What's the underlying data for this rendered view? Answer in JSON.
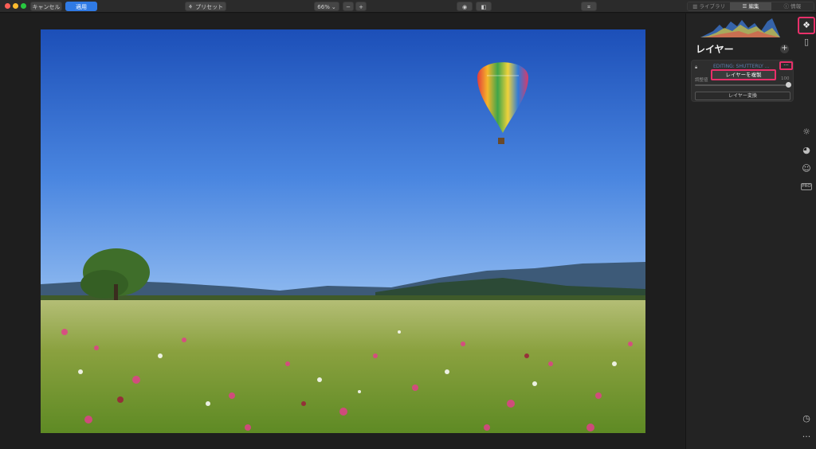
{
  "toolbar": {
    "cancel_label": "キャンセル",
    "apply_label": "適用",
    "presets_label": "プリセット",
    "zoom_label": "66%",
    "zoom_out_label": "−",
    "zoom_in_label": "+",
    "view_tabs": [
      "ライブラリ",
      "編集",
      "情報"
    ]
  },
  "panel": {
    "title": "レイヤー",
    "add_label": "+",
    "layer": {
      "name": "EDITING: SHUTTERLY ...",
      "more_label": "···",
      "tooltip": "レイヤーを複製",
      "opacity_label": "調整値",
      "opacity_value": "100",
      "convert_label": "レイヤー変換"
    }
  },
  "sidebar_icons": [
    "layers-icon",
    "canvas-icon",
    "sun-icon",
    "palette-icon",
    "face-icon",
    "pro-icon",
    "history-icon",
    "more-icon"
  ],
  "pro_label": "PRO",
  "colors": {
    "accent": "#2f7ae5",
    "highlight": "#e8306a"
  }
}
